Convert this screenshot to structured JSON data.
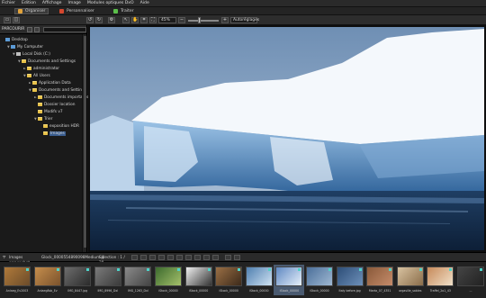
{
  "menu": [
    "Fichier",
    "Edition",
    "Affichage",
    "Image",
    "Modules optiques DxO",
    "Aide"
  ],
  "tabs": [
    {
      "label": "Organiser",
      "active": true,
      "icon": "organize-icon"
    },
    {
      "label": "Personnaliser",
      "active": false,
      "icon": "customize-icon"
    },
    {
      "label": "Traiter",
      "active": false,
      "icon": "process-icon"
    }
  ],
  "toolbar": {
    "zoom_value": "45%",
    "fit_mode": "Autoréglages"
  },
  "panel": {
    "title": "PARCOURIR"
  },
  "tree": [
    {
      "label": "Desktop",
      "level": 0,
      "icon": "desktop-icon",
      "twist": ""
    },
    {
      "label": "My Computer",
      "level": 1,
      "icon": "computer-icon",
      "twist": "▼"
    },
    {
      "label": "Local Disk (C:)",
      "level": 2,
      "icon": "drive-icon",
      "twist": "▼"
    },
    {
      "label": "Documents and Settings",
      "level": 3,
      "icon": "folder-icon",
      "twist": "▼"
    },
    {
      "label": "administrator",
      "level": 4,
      "icon": "folder-icon",
      "twist": "►"
    },
    {
      "label": "All Users",
      "level": 4,
      "icon": "folder-icon",
      "twist": "▼"
    },
    {
      "label": "Application Data",
      "level": 5,
      "icon": "folder-icon",
      "twist": "►"
    },
    {
      "label": "Documents and Settings",
      "level": 5,
      "icon": "folder-icon",
      "twist": "▼"
    },
    {
      "label": "Documents importants",
      "level": 6,
      "icon": "folder-icon",
      "twist": "►"
    },
    {
      "label": "Dossier location",
      "level": 6,
      "icon": "folder-icon",
      "twist": ""
    },
    {
      "label": "Modifs v7",
      "level": 6,
      "icon": "folder-icon",
      "twist": ""
    },
    {
      "label": "Trier",
      "level": 6,
      "icon": "folder-icon",
      "twist": "▼"
    },
    {
      "label": "exposition HDR",
      "level": 7,
      "icon": "folder-icon",
      "twist": ""
    },
    {
      "label": "Images",
      "level": 7,
      "icon": "folder-icon",
      "twist": "",
      "selected": true
    }
  ],
  "stripbar": {
    "label_left": "Images screenshot",
    "filename": "Glock_0000554890098Medium.jp",
    "selection_label": "Sélection : 1 / 28"
  },
  "thumbnails": [
    {
      "label": "Anlaeg_Ev2003",
      "colors": [
        "#b07a3a",
        "#6b4b2a"
      ],
      "selected": false
    },
    {
      "label": "Anlaeg8sb_Ev",
      "colors": [
        "#c58d4c",
        "#7a522c"
      ],
      "selected": false
    },
    {
      "label": "IMG_8447.jpg",
      "colors": [
        "#6d6d6d",
        "#2b2b2b"
      ],
      "selected": false
    },
    {
      "label": "IMG_8996_Dxl",
      "colors": [
        "#7a7a7a",
        "#3a3a3a"
      ],
      "selected": false
    },
    {
      "label": "IMG_1263_Dxl",
      "colors": [
        "#8a8a8a",
        "#444"
      ],
      "selected": false
    },
    {
      "label": "iStock_00000",
      "colors": [
        "#3c6a2e",
        "#a4c06a"
      ],
      "selected": false
    },
    {
      "label": "iStock_00000",
      "colors": [
        "#f0f0f0",
        "#333"
      ],
      "selected": false
    },
    {
      "label": "iStock_00000",
      "colors": [
        "#9a6f45",
        "#3d2a1a"
      ],
      "selected": false
    },
    {
      "label": "iStock_00000",
      "colors": [
        "#4f7fb0",
        "#cfe2f2"
      ],
      "selected": false
    },
    {
      "label": "iStock_00000",
      "colors": [
        "#5f88c2",
        "#e6f0fa"
      ],
      "selected": true
    },
    {
      "label": "iStock_00000",
      "colors": [
        "#4b6f9a",
        "#9fb8d2"
      ],
      "selected": false
    },
    {
      "label": "Italy before.jpg",
      "colors": [
        "#2d4e78",
        "#6d8fb8"
      ],
      "selected": false
    },
    {
      "label": "Marta_07_4351",
      "colors": [
        "#8a5a3a",
        "#c58b6a"
      ],
      "selected": false
    },
    {
      "label": "orgasille_sables",
      "colors": [
        "#d8c2a0",
        "#8a6d4a"
      ],
      "selected": false
    },
    {
      "label": "Traffel_2o1_43",
      "colors": [
        "#c78a5a",
        "#f0e0c8"
      ],
      "selected": false
    },
    {
      "label": "...",
      "colors": [
        "#444",
        "#222"
      ],
      "selected": false
    }
  ],
  "colors": {
    "accent_selected": "#3a5d8f",
    "badge": "#4fd2c8",
    "folder": "#e8c24a"
  }
}
